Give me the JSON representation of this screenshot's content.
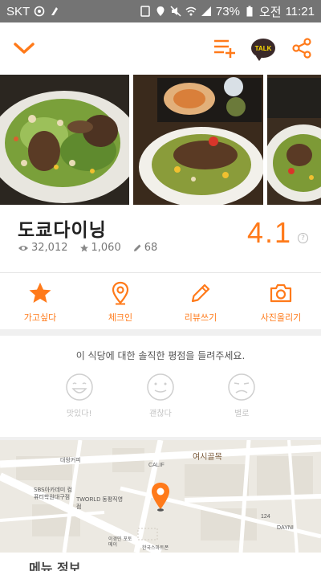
{
  "status_bar": {
    "carrier": "SKT",
    "battery": "73%",
    "ampm": "오전",
    "time": "11:21"
  },
  "app_bar": {
    "icons": [
      "chevron-down-icon",
      "playlist-add-icon",
      "kakao-talk-icon",
      "share-icon"
    ],
    "talk_label": "TALK",
    "accent_color": "#ff7a1a"
  },
  "restaurant": {
    "name": "도쿄다이닝",
    "views": "32,012",
    "favorites": "1,060",
    "reviews": "68",
    "rating": "4.1",
    "help": "?"
  },
  "actions": [
    {
      "label": "가고싶다",
      "icon": "star-icon"
    },
    {
      "label": "체크인",
      "icon": "location-pin-icon"
    },
    {
      "label": "리뷰쓰기",
      "icon": "pencil-icon"
    },
    {
      "label": "사진올리기",
      "icon": "camera-icon"
    }
  ],
  "review_prompt": {
    "text": "이 식당에 대한 솔직한 평점을 들려주세요.",
    "options": [
      {
        "label": "맛있다!",
        "icon": "happy-face-icon"
      },
      {
        "label": "괜찮다",
        "icon": "neutral-face-icon"
      },
      {
        "label": "별로",
        "icon": "sad-face-icon"
      }
    ]
  },
  "map": {
    "labels": {
      "area": "여시골목",
      "store1": "TWORLD 동평직영점",
      "academy": "SBS아카데미 컴퓨터학원대구점",
      "cafe": "CALIF",
      "daynim": "DAYNI",
      "building_num": "124",
      "coffee": "대왕커피",
      "korean_store": "한국스마트폰",
      "ice": "이경민 포토메이"
    }
  },
  "next_section": {
    "title": "메뉴 정보"
  }
}
